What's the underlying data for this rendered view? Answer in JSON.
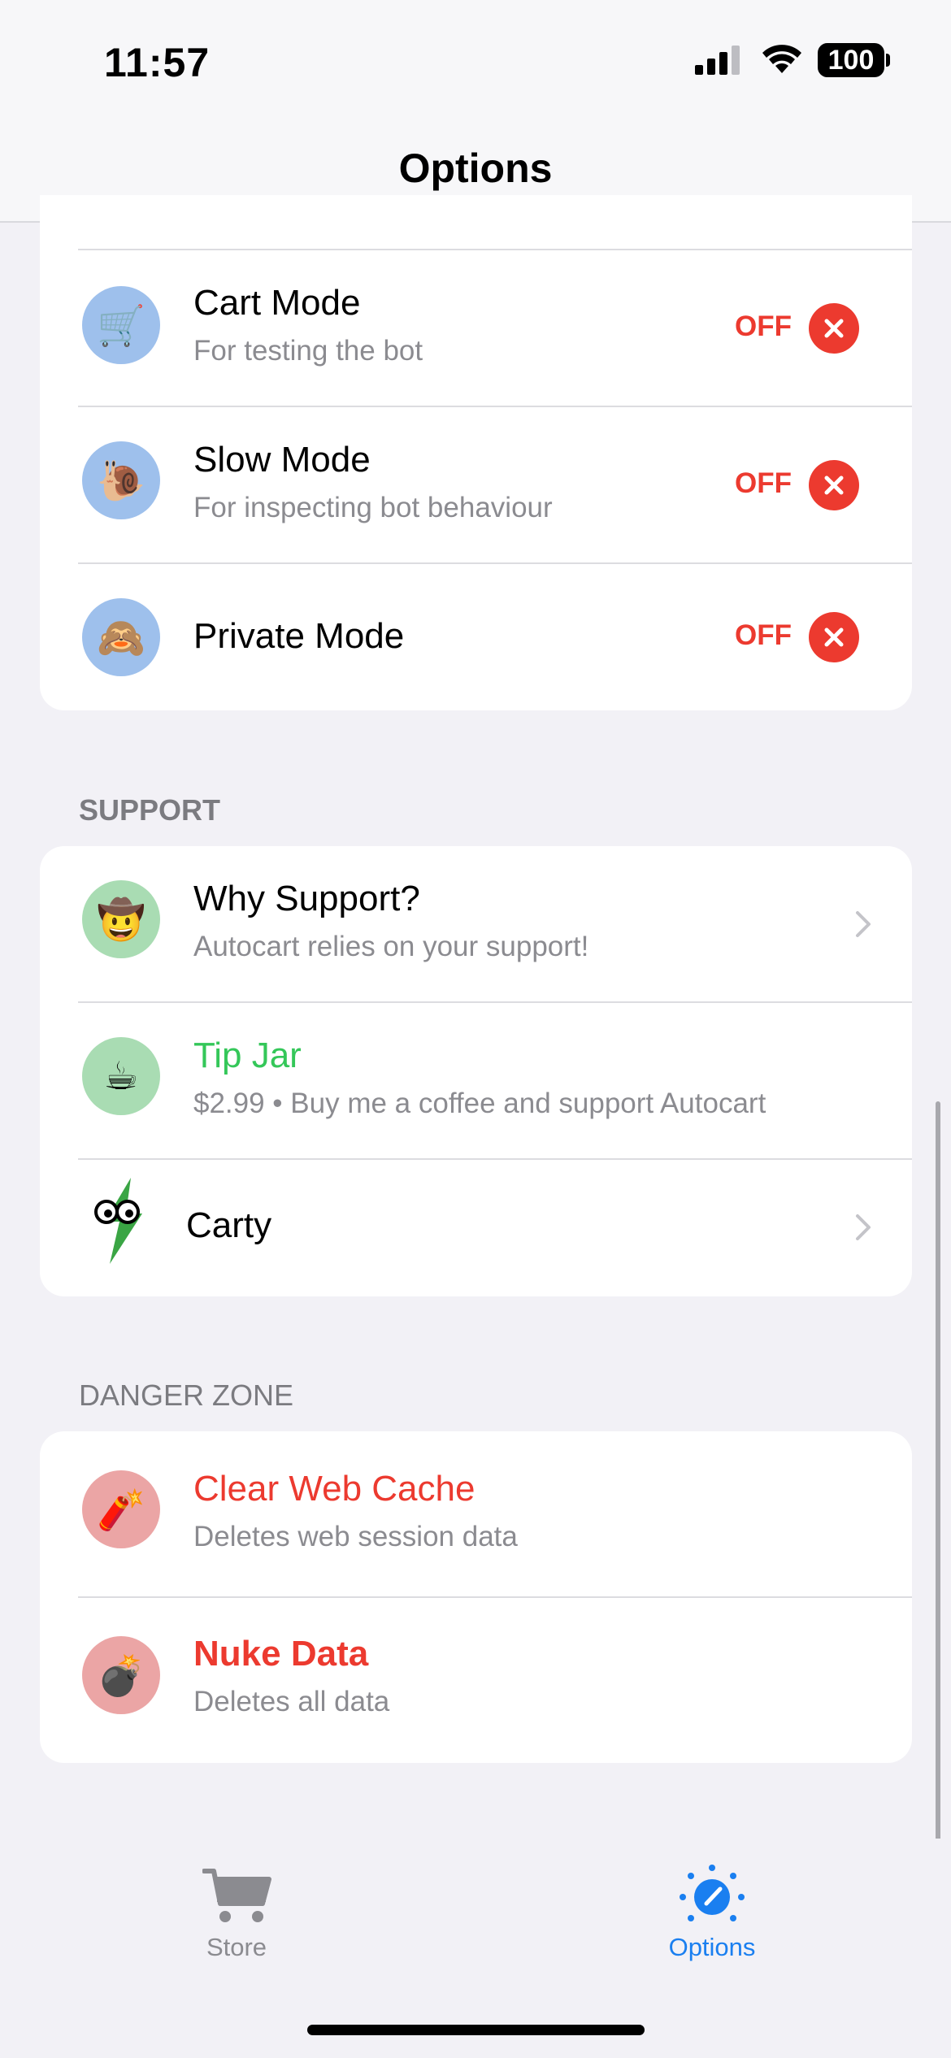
{
  "status_bar": {
    "time": "11:57",
    "battery": "100"
  },
  "nav": {
    "title": "Options"
  },
  "modes": [
    {
      "title": "Cart Mode",
      "subtitle": "For testing the bot",
      "state": "OFF",
      "icon": "cart-icon",
      "emoji": "🛒"
    },
    {
      "title": "Slow Mode",
      "subtitle": "For inspecting bot behaviour",
      "state": "OFF",
      "icon": "snail-icon",
      "emoji": "🐌"
    },
    {
      "title": "Private Mode",
      "subtitle": "",
      "state": "OFF",
      "icon": "see-no-evil-monkey-icon",
      "emoji": "🙈"
    }
  ],
  "support": {
    "header": "SUPPORT",
    "items": [
      {
        "title": "Why Support?",
        "subtitle": "Autocart relies on your support!",
        "icon": "cowboy-face-icon",
        "emoji": "🤠"
      },
      {
        "title": "Tip Jar",
        "subtitle": "$2.99 • Buy me a coffee and support Autocart",
        "icon": "coffee-icon",
        "emoji": "☕"
      },
      {
        "title": "Carty",
        "subtitle": "",
        "icon": "carty-lightning-icon"
      }
    ]
  },
  "danger": {
    "header": "DANGER ZONE",
    "items": [
      {
        "title": "Clear Web Cache",
        "subtitle": "Deletes web session data",
        "icon": "firecracker-icon",
        "emoji": "🧨"
      },
      {
        "title": "Nuke Data",
        "subtitle": "Deletes all data",
        "icon": "bomb-icon",
        "emoji": "💣"
      }
    ]
  },
  "tabs": [
    {
      "label": "Store",
      "icon": "cart-tab-icon",
      "active": false
    },
    {
      "label": "Options",
      "icon": "gauge-tab-icon",
      "active": true
    }
  ],
  "colors": {
    "accent": "#1a7ff0",
    "danger": "#ec3a2f",
    "success": "#34c759",
    "inactive": "#8b8b90"
  }
}
